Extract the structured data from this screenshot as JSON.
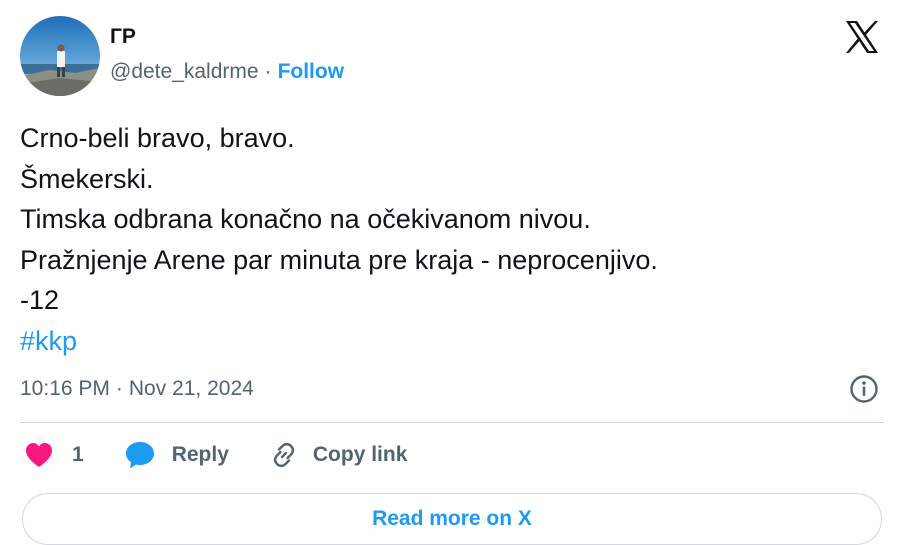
{
  "author": {
    "display_name": "ГР",
    "handle": "@dete_kaldrme",
    "separator": "·",
    "follow_label": "Follow"
  },
  "tweet": {
    "lines": [
      "Crno-beli bravo, bravo.",
      "Šmekerski.",
      "Timska odbrana konačno na očekivanom nivou.",
      "Pražnjenje Arene par minuta pre kraja - neprocenjivo.",
      "-12"
    ],
    "hashtag": "#kkp"
  },
  "meta": {
    "time": "10:16 PM",
    "separator": "·",
    "date": "Nov 21, 2024"
  },
  "actions": {
    "like_count": "1",
    "reply_label": "Reply",
    "copy_link_label": "Copy link"
  },
  "read_more_label": "Read more on X",
  "icons": {
    "brand": "x-logo-icon",
    "info": "info-icon",
    "like": "heart-icon",
    "reply": "speech-bubble-icon",
    "copy": "link-icon"
  },
  "colors": {
    "accent": "#1d9bf0",
    "like": "#f91880",
    "muted_text": "#536471",
    "primary_text": "#0f1419",
    "border": "#cfd9de"
  }
}
